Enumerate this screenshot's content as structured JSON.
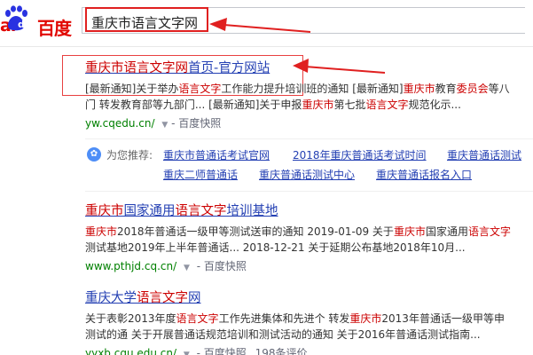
{
  "logo": {
    "prefix": "ai",
    "paw_text": "du",
    "cn": "百度"
  },
  "search": {
    "query": "重庆市语言文字网"
  },
  "results": [
    {
      "title_parts": [
        {
          "t": "重庆市语言文字网",
          "hl": true
        },
        {
          "t": "首页-官方网站",
          "hl": false
        }
      ],
      "abstract_line1": [
        {
          "t": "[最新通知]关于举办",
          "hl": false
        },
        {
          "t": "语言文字",
          "hl": true
        },
        {
          "t": "工作能力提升培训班的通知 [最新通知]",
          "hl": false
        },
        {
          "t": "重庆市",
          "hl": true
        },
        {
          "t": "教育",
          "hl": false
        },
        {
          "t": "委员会",
          "hl": true
        },
        {
          "t": "等八",
          "hl": false
        }
      ],
      "abstract_line2": [
        {
          "t": "门 转发教育部等九部门... [最新通知]关于申报",
          "hl": false
        },
        {
          "t": "重庆市",
          "hl": true
        },
        {
          "t": "第七批",
          "hl": false
        },
        {
          "t": "语言文字",
          "hl": true
        },
        {
          "t": "规范化示...",
          "hl": false
        }
      ],
      "url": "yw.cqedu.cn/",
      "snapshot": "百度快照"
    },
    {
      "title_parts": [
        {
          "t": "重庆市",
          "hl": true
        },
        {
          "t": "国家通用",
          "hl": false
        },
        {
          "t": "语言文字",
          "hl": true
        },
        {
          "t": "培训基地",
          "hl": false
        }
      ],
      "abstract_line1": [
        {
          "t": "重庆市",
          "hl": true
        },
        {
          "t": "2018年普通话一级甲等测试送审的通知 2019-01-09 关于",
          "hl": false
        },
        {
          "t": "重庆市",
          "hl": true
        },
        {
          "t": "国家通用",
          "hl": false
        },
        {
          "t": "语言文字",
          "hl": true
        }
      ],
      "abstract_line2": [
        {
          "t": "测试基地2019年上半年普通话... 2018-12-21 关于延期公布基地2018年10月...",
          "hl": false
        }
      ],
      "url": "www.pthjd.cq.cn/",
      "snapshot": "百度快照"
    },
    {
      "title_parts": [
        {
          "t": "重庆大学",
          "hl": false
        },
        {
          "t": "语言文字",
          "hl": true
        },
        {
          "t": "网",
          "hl": false
        }
      ],
      "abstract_line1": [
        {
          "t": "关于表彰2013年度",
          "hl": false
        },
        {
          "t": "语言文字",
          "hl": true
        },
        {
          "t": "工作先进集体和先进个 转发",
          "hl": false
        },
        {
          "t": "重庆市",
          "hl": true
        },
        {
          "t": "2013年普通话一级甲等申",
          "hl": false
        }
      ],
      "abstract_line2": [
        {
          "t": "测试的通 关于开展普通话规范培训和测试活动的通知 关于2016年普通话测试指南...",
          "hl": false
        }
      ],
      "url": "yyxb.cqu.edu.cn/",
      "snapshot": "百度快照",
      "extra": "198条评价"
    }
  ],
  "recommend": {
    "label": "为您推荐:",
    "links": [
      "重庆市普通话考试官网",
      "2018年重庆普通话考试时间",
      "重庆普通话测试",
      "重庆二师普通话",
      "重庆普通话测试中心",
      "重庆普通话报名入口"
    ]
  },
  "colors": {
    "brand": "#e10601",
    "link": "#2440b3",
    "highlight": "#cc0000",
    "url": "#008000"
  }
}
